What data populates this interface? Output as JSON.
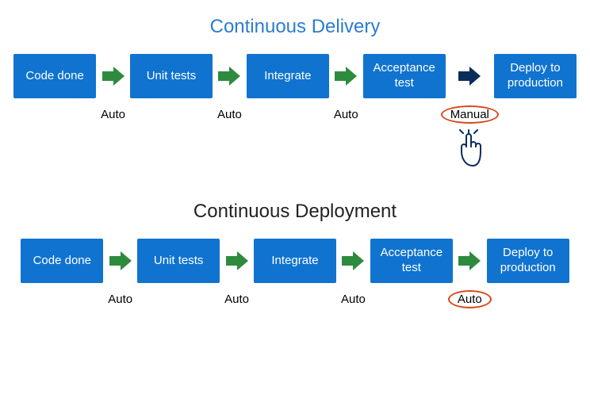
{
  "colors": {
    "box_bg": "#1073cf",
    "box_fg": "#ffffff",
    "arrow_auto": "#2e8b3d",
    "arrow_manual": "#0a2d5a",
    "circle": "#d64a1a",
    "title_blue": "#2b7cd3",
    "title_dark": "#222222"
  },
  "delivery": {
    "title": "Continuous Delivery",
    "stages": [
      "Code done",
      "Unit tests",
      "Integrate",
      "Acceptance test",
      "Deploy to production"
    ],
    "arrows": [
      {
        "label": "Auto",
        "type": "auto",
        "circled": false
      },
      {
        "label": "Auto",
        "type": "auto",
        "circled": false
      },
      {
        "label": "Auto",
        "type": "auto",
        "circled": false
      },
      {
        "label": "Manual",
        "type": "manual",
        "circled": true,
        "hand_icon": true
      }
    ]
  },
  "deployment": {
    "title": "Continuous Deployment",
    "stages": [
      "Code done",
      "Unit tests",
      "Integrate",
      "Acceptance test",
      "Deploy to production"
    ],
    "arrows": [
      {
        "label": "Auto",
        "type": "auto",
        "circled": false
      },
      {
        "label": "Auto",
        "type": "auto",
        "circled": false
      },
      {
        "label": "Auto",
        "type": "auto",
        "circled": false
      },
      {
        "label": "Auto",
        "type": "auto",
        "circled": true
      }
    ]
  }
}
